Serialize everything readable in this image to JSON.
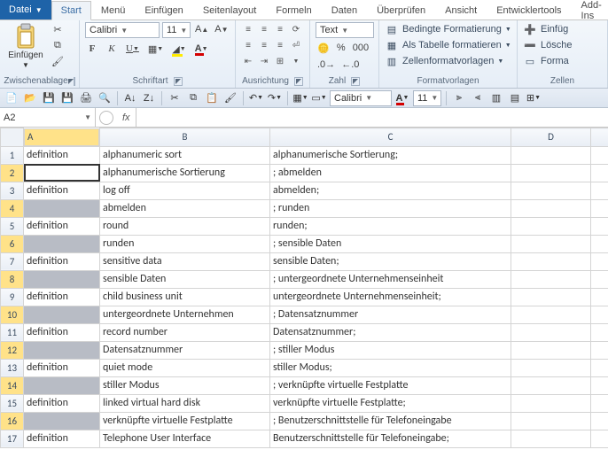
{
  "app": {
    "file_tab": "Datei"
  },
  "tabs": [
    "Start",
    "Menü",
    "Einfügen",
    "Seitenlayout",
    "Formeln",
    "Daten",
    "Überprüfen",
    "Ansicht",
    "Entwicklertools",
    "Add-Ins"
  ],
  "active_tab_index": 0,
  "ribbon": {
    "clipboard": {
      "title": "Zwischenablage",
      "paste": "Einfügen"
    },
    "font": {
      "title": "Schriftart",
      "name": "Calibri",
      "size": "11"
    },
    "alignment": {
      "title": "Ausrichtung"
    },
    "number": {
      "title": "Zahl",
      "format": "Text"
    },
    "styles": {
      "title": "Formatvorlagen",
      "cond": "Bedingte Formatierung",
      "as_table": "Als Tabelle formatieren",
      "cell": "Zellenformatvorlagen"
    },
    "cells": {
      "title": "Zellen",
      "insert": "Einfüg",
      "delete": "Lösche",
      "format": "Forma"
    }
  },
  "qat_font": {
    "name": "Calibri",
    "size": "11"
  },
  "namebox": "A2",
  "formula": "",
  "columns": [
    "A",
    "B",
    "C",
    "D"
  ],
  "selected_column_index": 0,
  "active_cell": {
    "row": 2,
    "col": 0
  },
  "rows": [
    {
      "n": 1,
      "a": "definition",
      "b": "alphanumeric sort",
      "c": "alphanumerische Sortierung;",
      "grey": false
    },
    {
      "n": 2,
      "a": "",
      "b": "alphanumerische Sortierung",
      "c": "; abmelden",
      "grey": true
    },
    {
      "n": 3,
      "a": "definition",
      "b": "log off",
      "c": "abmelden;",
      "grey": false
    },
    {
      "n": 4,
      "a": "",
      "b": "abmelden",
      "c": "; runden",
      "grey": true
    },
    {
      "n": 5,
      "a": "definition",
      "b": "round",
      "c": "runden;",
      "grey": false
    },
    {
      "n": 6,
      "a": "",
      "b": "runden",
      "c": "; sensible Daten",
      "grey": true
    },
    {
      "n": 7,
      "a": "definition",
      "b": "sensitive data",
      "c": "sensible Daten;",
      "grey": false
    },
    {
      "n": 8,
      "a": "",
      "b": "sensible Daten",
      "c": "; untergeordnete Unternehmenseinheit",
      "grey": true
    },
    {
      "n": 9,
      "a": "definition",
      "b": "child business unit",
      "c": "untergeordnete Unternehmenseinheit;",
      "grey": false
    },
    {
      "n": 10,
      "a": "",
      "b": "untergeordnete Unternehmen",
      "c": "; Datensatznummer",
      "grey": true
    },
    {
      "n": 11,
      "a": "definition",
      "b": "record number",
      "c": "Datensatznummer;",
      "grey": false
    },
    {
      "n": 12,
      "a": "",
      "b": "Datensatznummer",
      "c": "; stiller Modus",
      "grey": true
    },
    {
      "n": 13,
      "a": "definition",
      "b": "quiet mode",
      "c": "stiller Modus;",
      "grey": false
    },
    {
      "n": 14,
      "a": "",
      "b": "stiller Modus",
      "c": "; verknüpfte virtuelle Festplatte",
      "grey": true
    },
    {
      "n": 15,
      "a": "definition",
      "b": "linked virtual hard disk",
      "c": "verknüpfte virtuelle Festplatte;",
      "grey": false
    },
    {
      "n": 16,
      "a": "",
      "b": "verknüpfte virtuelle Festplatte",
      "c": "; Benutzerschnittstelle für Telefoneingabe",
      "grey": true
    },
    {
      "n": 17,
      "a": "definition",
      "b": "Telephone User Interface",
      "c": "Benutzerschnittstelle für Telefoneingabe;",
      "grey": false
    }
  ]
}
